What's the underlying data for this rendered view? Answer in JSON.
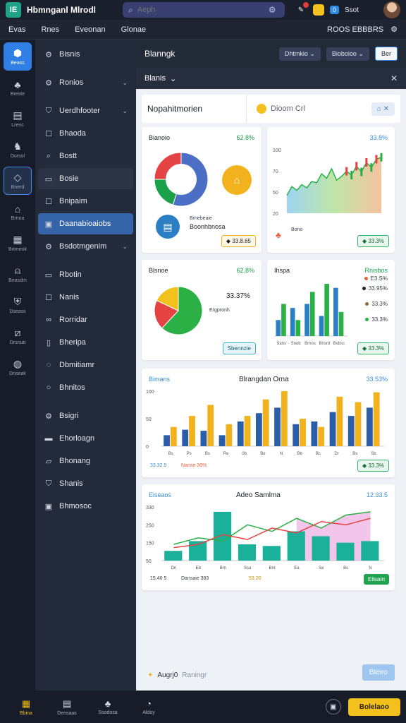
{
  "topbar": {
    "logo": "IE",
    "title": "Hbmnganl Mlrodl",
    "search_placeholder": "Aeph",
    "badge": "0",
    "account": "Ssot"
  },
  "menubar": {
    "items": [
      "Evas",
      "Rnes",
      "Eveonan",
      "Glonae"
    ],
    "right_text": "ROOS EBBBRS"
  },
  "rail": {
    "items": [
      {
        "icon": "home-icon",
        "label": "Beass"
      },
      {
        "icon": "bag-icon",
        "label": "Breste"
      },
      {
        "icon": "grid-icon",
        "label": "Lrenc"
      },
      {
        "icon": "person-icon",
        "label": "Dorsol"
      },
      {
        "icon": "tag-icon",
        "label": "Bnerd"
      },
      {
        "icon": "doc-icon",
        "label": "Brnoa"
      },
      {
        "icon": "chart-icon",
        "label": "Brtmeok"
      },
      {
        "icon": "user-icon",
        "label": "Beasdm"
      },
      {
        "icon": "shield-icon",
        "label": "Dseass"
      },
      {
        "icon": "graph-icon",
        "label": "Drsrsat"
      },
      {
        "icon": "globe-icon",
        "label": "Dnseak"
      }
    ]
  },
  "sidebar": {
    "items": [
      {
        "icon": "gear-icon",
        "label": "Bisnis",
        "chev": ""
      },
      {
        "icon": "gear-icon",
        "label": "Ronios",
        "chev": "⌄"
      },
      {
        "icon": "shield-icon",
        "label": "Uerdhfooter",
        "chev": "⌄"
      },
      {
        "icon": "square-icon",
        "label": "Bhaoda",
        "chev": ""
      },
      {
        "icon": "search-icon",
        "label": "Bostt",
        "chev": ""
      },
      {
        "icon": "card-icon",
        "label": "Bosie",
        "chev": ""
      },
      {
        "icon": "square-icon",
        "label": "Bnipaim",
        "chev": ""
      },
      {
        "icon": "card-icon",
        "label": "Daanabioaiobs",
        "chev": ""
      },
      {
        "icon": "gear-icon",
        "label": "Bsdotmgenim",
        "chev": "⌄"
      },
      {
        "icon": "card-icon",
        "label": "Rbotin",
        "chev": ""
      },
      {
        "icon": "square-icon",
        "label": "Nanis",
        "chev": ""
      },
      {
        "icon": "link-icon",
        "label": "Rorridar",
        "chev": ""
      },
      {
        "icon": "doc-icon",
        "label": "Bheripa",
        "chev": ""
      },
      {
        "icon": "bubble-icon",
        "label": "Dbmitiamr",
        "chev": ""
      },
      {
        "icon": "circle-icon",
        "label": "Bhnitos",
        "chev": ""
      },
      {
        "icon": "gear-icon",
        "label": "Bsigri",
        "chev": ""
      },
      {
        "icon": "card-icon",
        "label": "Ehorloagn",
        "chev": ""
      },
      {
        "icon": "doc-icon",
        "label": "Bhonang",
        "chev": ""
      },
      {
        "icon": "shield-icon",
        "label": "Shanis",
        "chev": ""
      },
      {
        "icon": "doc-icon",
        "label": "Bhmosoc",
        "chev": ""
      }
    ]
  },
  "main": {
    "header_title": "Blanngk",
    "select1": "Dhtmkio ⌄",
    "select2": "Bioboioo ⌄",
    "button": "Ber",
    "subhead": "Blanis",
    "panel_title": "Nopahitmorien",
    "panel_tab": "Dioom Crl",
    "panel_tools": "⌂ ✕"
  },
  "cards": {
    "c1": {
      "title": "Bianoio",
      "pct": "62.8%",
      "label": "Boonhbnosa",
      "sub": "Brnebeaie",
      "pill": "◆ 33.8.65"
    },
    "c2": {
      "title": "",
      "pct": "33.8%",
      "pill": "◆ 33.3%",
      "label": "Bono"
    },
    "c3": {
      "title": "Blsnoe",
      "pct": "62.8%",
      "big": "33.37%",
      "sub": "Ergpronh",
      "pill": "Sbennzie"
    },
    "c4": {
      "title": "Ihspa",
      "pct": "Rnisbos",
      "pill": "◆ 33.3%",
      "legend": [
        "E3.S%",
        "33.95%",
        "33.3%",
        "33.3%"
      ]
    },
    "c5": {
      "title": "Bimans",
      "center": "Blrangdan Orna",
      "pct": "33.53%",
      "foot1": "33.32.9",
      "foot2": "Nanse 36%",
      "pill": "◆ 33.3%"
    },
    "c6": {
      "title": "Eiseaos",
      "center": "Adeo Samlma",
      "pct": "12.33.5",
      "foot1": "15.40 5",
      "foot2": "Dansaie 383",
      "foot3": "53.20",
      "pill": "Eilsam"
    }
  },
  "footer": {
    "label": "Augrj0",
    "muted": "Raningr",
    "button": "Bteiro"
  },
  "bottombar": {
    "items": [
      {
        "icon": "grid-icon",
        "label": "Bbina"
      },
      {
        "icon": "card-icon",
        "label": "Densaas"
      },
      {
        "icon": "bag-icon",
        "label": "Ssodosa"
      },
      {
        "icon": "chat-icon",
        "label": "Aldoy"
      }
    ],
    "cta": "Bolelaoo"
  },
  "chart_data": [
    {
      "type": "pie",
      "title": "Bianoio",
      "values": [
        55,
        20,
        25
      ],
      "colors": [
        "#4a6fc4",
        "#1aa14a",
        "#e54343"
      ]
    },
    {
      "type": "area",
      "title": "",
      "x": [
        1,
        2,
        3,
        4,
        5,
        6,
        7,
        8,
        9,
        10,
        11,
        12,
        13,
        14,
        15,
        16,
        17,
        18,
        19,
        20
      ],
      "ylim": [
        0,
        100
      ],
      "yticks": [
        "100",
        "70",
        "50",
        "20"
      ],
      "values": [
        28,
        42,
        36,
        45,
        40,
        50,
        48,
        62,
        55,
        70,
        52,
        58,
        66,
        60,
        74,
        65,
        80,
        72,
        85,
        88
      ]
    },
    {
      "type": "pie",
      "title": "Blsnoe",
      "values": [
        62,
        20,
        18
      ],
      "colors": [
        "#2bb046",
        "#e54343",
        "#f2c11d"
      ]
    },
    {
      "type": "bar",
      "title": "Ihspa",
      "categories": [
        "Sans",
        "Snob",
        "Brnos",
        "Bnsrd",
        "Bsbsc"
      ],
      "series": [
        {
          "values": [
            20,
            35,
            40,
            25,
            60
          ],
          "color": "#2b7fc4"
        },
        {
          "values": [
            40,
            20,
            55,
            65,
            30
          ],
          "color": "#2bb046"
        }
      ]
    },
    {
      "type": "bar",
      "title": "Bimans",
      "categories": [
        "Bs",
        "Ps",
        "Bs",
        "Re",
        "0b",
        "Be",
        "N",
        "Bb",
        "Bc",
        "Dr",
        "Bs",
        "Sb"
      ],
      "ylim": [
        0,
        100
      ],
      "yticks": [
        "100",
        "50",
        "0"
      ],
      "series": [
        {
          "values": [
            20,
            30,
            28,
            20,
            45,
            60,
            70,
            40,
            45,
            62,
            55,
            70
          ],
          "color": "#2b5ea8"
        },
        {
          "values": [
            35,
            55,
            75,
            40,
            55,
            85,
            100,
            50,
            35,
            90,
            80,
            98
          ],
          "color": "#f2b21d"
        }
      ]
    },
    {
      "type": "bar",
      "title": "Eiseaos",
      "categories": [
        "Dn",
        "Eb",
        "Bm",
        "Ssa",
        "Bnt",
        "Ea",
        "Se",
        "Bs",
        "N"
      ],
      "ylim": [
        0,
        330
      ],
      "yticks": [
        "330",
        "250",
        "150",
        "50"
      ],
      "series": [
        {
          "values": [
            60,
            120,
            300,
            100,
            90,
            180,
            150,
            110,
            120
          ],
          "color": "#1ab09a"
        }
      ],
      "lines": [
        {
          "values": [
            100,
            140,
            120,
            220,
            180,
            260,
            200,
            280,
            300
          ],
          "color": "#2bb046"
        },
        {
          "values": [
            80,
            100,
            160,
            130,
            200,
            170,
            240,
            220,
            260
          ],
          "color": "#e54343"
        }
      ]
    }
  ]
}
